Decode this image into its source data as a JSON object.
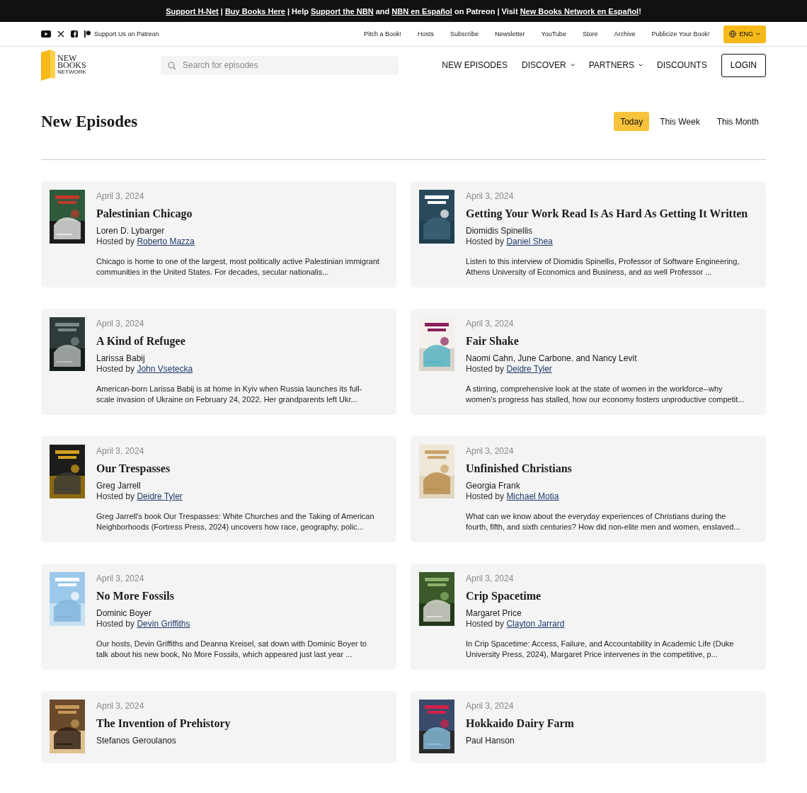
{
  "announcement": [
    {
      "text": "Support H-Net",
      "link": true
    },
    {
      "text": " | ",
      "link": false
    },
    {
      "text": "Buy Books Here",
      "link": true
    },
    {
      "text": " | Help ",
      "link": false
    },
    {
      "text": "Support the NBN",
      "link": true
    },
    {
      "text": " and ",
      "link": false
    },
    {
      "text": "NBN en Español",
      "link": true
    },
    {
      "text": " on Patreon | Visit ",
      "link": false
    },
    {
      "text": "New Books Network en Español",
      "link": true
    },
    {
      "text": "!",
      "link": false
    }
  ],
  "utility_bar": {
    "social": [
      {
        "kind": "youtube"
      },
      {
        "kind": "x"
      },
      {
        "kind": "facebook"
      },
      {
        "kind": "patreon",
        "label": "Support Us on Patreon"
      }
    ],
    "links": [
      "Pitch a Book!",
      "Hosts",
      "Subscribe",
      "Newsletter",
      "YouTube",
      "Store",
      "Archive",
      "Publicize Your Book!"
    ],
    "language": "ENG"
  },
  "header": {
    "logo_lines": [
      "NEW",
      "BOOKS",
      "NETWORK"
    ],
    "search": {
      "placeholder": "Search for episodes"
    },
    "nav": [
      {
        "label": "NEW EPISODES",
        "dropdown": false
      },
      {
        "label": "DISCOVER",
        "dropdown": true
      },
      {
        "label": "PARTNERS",
        "dropdown": true
      },
      {
        "label": "DISCOUNTS",
        "dropdown": false
      }
    ],
    "login": "LOGIN"
  },
  "page": {
    "title": "New Episodes",
    "filters": [
      {
        "label": "Today",
        "selected": true
      },
      {
        "label": "This Week",
        "selected": false
      },
      {
        "label": "This Month",
        "selected": false
      }
    ]
  },
  "episodes": [
    {
      "date": "April 3, 2024",
      "title": "Palestinian Chicago",
      "author": "Loren D. Lybarger",
      "host_prefix": "Hosted by",
      "host": "Roberto Mazza",
      "description": "Chicago is home to one of the largest, most politically active Palestinian immigrant communities in the United States. For decades, secular nationalis..."
    },
    {
      "date": "April 3, 2024",
      "title": "Getting Your Work Read Is As Hard As Getting It Written",
      "author": "Diomidis Spinellis",
      "host_prefix": "Hosted by",
      "host": "Daniel Shea",
      "description": "Listen to this interview of Diomidis Spinellis, Professor of Software Engineering, Athens University of Economics and Business, and as well Professor ..."
    },
    {
      "date": "April 3, 2024",
      "title": "A Kind of Refugee",
      "author": "Larissa Babij",
      "host_prefix": "Hosted by",
      "host": "John Vsetecka",
      "description": "American-born Larissa Babij is at home in Kyiv when Russia launches its full-scale invasion of Ukraine on February 24, 2022. Her grandparents left Ukr..."
    },
    {
      "date": "April 3, 2024",
      "title": "Fair Shake",
      "author": "Naomi Cahn, June Carbone. and Nancy Levit",
      "host_prefix": "Hosted by",
      "host": "Deidre Tyler",
      "description": "A stirring, comprehensive look at the state of women in the workforce--why women's progress has stalled, how our economy fosters unproductive competit..."
    },
    {
      "date": "April 3, 2024",
      "title": "Our Trespasses",
      "author": "Greg Jarrell",
      "host_prefix": "Hosted by",
      "host": "Deidre Tyler",
      "description": "Greg Jarrell's book Our Trespasses: White Churches and the Taking of American Neighborhoods (Fortress Press, 2024) uncovers how race, geography, polic..."
    },
    {
      "date": "April 3, 2024",
      "title": "Unfinished Christians",
      "author": "Georgia Frank",
      "host_prefix": "Hosted by",
      "host": "Michael Motia",
      "description": "What can we know about the everyday experiences of Christians during the fourth, fifth, and sixth centuries? How did non-elite men and women, enslaved..."
    },
    {
      "date": "April 3, 2024",
      "title": "No More Fossils",
      "author": "Dominic Boyer",
      "host_prefix": "Hosted by",
      "host": "Devin Griffiths",
      "description": "Our hosts, Devin Griffiths and Deanna Kreisel, sat down with Dominic Boyer to talk about his new book, No More Fossils, which appeared just last year ..."
    },
    {
      "date": "April 3, 2024",
      "title": "Crip Spacetime",
      "author": "Margaret Price",
      "host_prefix": "Hosted by",
      "host": "Clayton Jarrard",
      "description": "In Crip Spacetime: Access, Failure, and Accountability in Academic Life (Duke University Press, 2024), Margaret Price intervenes in the competitive, p..."
    },
    {
      "date": "April 3, 2024",
      "title": "The Invention of Prehistory",
      "author": "Stefanos Geroulanos"
    },
    {
      "date": "April 3, 2024",
      "title": "Hokkaido Dairy Farm",
      "author": "Paul Hanson"
    }
  ]
}
